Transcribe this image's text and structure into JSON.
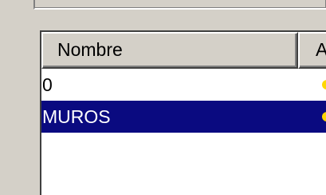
{
  "listview": {
    "columns": [
      {
        "label": "Nombre"
      },
      {
        "label": "A"
      }
    ],
    "rows": [
      {
        "name": "0",
        "selected": false,
        "swatch_color": "#ffd700"
      },
      {
        "name": "MUROS",
        "selected": true,
        "swatch_color": "#ffd700"
      }
    ]
  },
  "colors": {
    "window_bg": "#d4d0c8",
    "selection_bg": "#0a0a80",
    "list_bg": "#ffffff"
  }
}
